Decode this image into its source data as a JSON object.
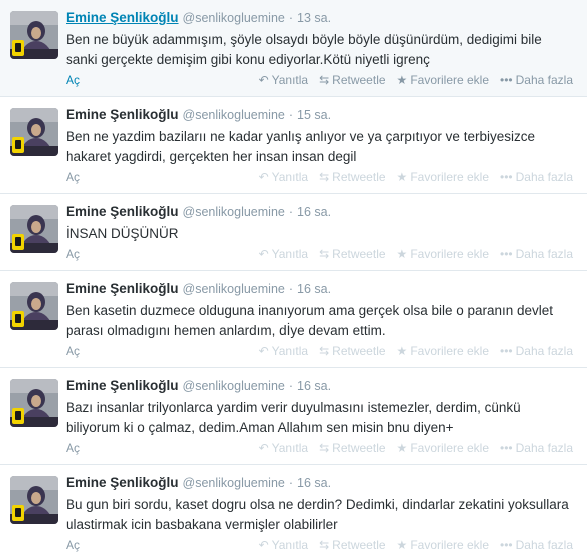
{
  "tweets": [
    {
      "fullname": "Emine Şenlikoğlu",
      "username": "@senlikogluemine",
      "time": "13 sa.",
      "text": "Ben ne büyük adammışım, şöyle olsaydı böyle böyle düşünürdüm, dedigimi bile sanki gerçekte demişim gibi konu ediyorlar.Kötü niyetli igrenç",
      "expand": "Aç",
      "reply": "Yanıtla",
      "retweet": "Retweetle",
      "favorite": "Favorilere ekle",
      "more": "Daha fazla"
    },
    {
      "fullname": "Emine Şenlikoğlu",
      "username": "@senlikogluemine",
      "time": "15 sa.",
      "text": "Ben ne yazdim bazilarıı ne kadar yanlış anlıyor ve ya çarpıtıyor ve terbiyesizce hakaret yagdirdi, gerçekten her insan insan degil",
      "expand": "Aç",
      "reply": "Yanıtla",
      "retweet": "Retweetle",
      "favorite": "Favorilere ekle",
      "more": "Daha fazla"
    },
    {
      "fullname": "Emine Şenlikoğlu",
      "username": "@senlikogluemine",
      "time": "16 sa.",
      "text": "İNSAN DÜŞÜNÜR",
      "expand": "Aç",
      "reply": "Yanıtla",
      "retweet": "Retweetle",
      "favorite": "Favorilere ekle",
      "more": "Daha fazla"
    },
    {
      "fullname": "Emine Şenlikoğlu",
      "username": "@senlikogluemine",
      "time": "16 sa.",
      "text": "Ben kasetin duzmece olduguna inanıyorum ama gerçek olsa bile o paranın devlet parası olmadıgını hemen anlardım, dİye devam ettim.",
      "expand": "Aç",
      "reply": "Yanıtla",
      "retweet": "Retweetle",
      "favorite": "Favorilere ekle",
      "more": "Daha fazla"
    },
    {
      "fullname": "Emine Şenlikoğlu",
      "username": "@senlikogluemine",
      "time": "16 sa.",
      "text": "Bazı insanlar trilyonlarca yardim verir duyulmasını istemezler, derdim, cünkü biliyorum ki o çalmaz, dedim.Aman Allahım sen misin bnu diyen+",
      "expand": "Aç",
      "reply": "Yanıtla",
      "retweet": "Retweetle",
      "favorite": "Favorilere ekle",
      "more": "Daha fazla"
    },
    {
      "fullname": "Emine Şenlikoğlu",
      "username": "@senlikogluemine",
      "time": "16 sa.",
      "text": "Bu gun biri sordu, kaset dogru olsa ne derdin? Dedimki, dindarlar zekatini yoksullara ulastirmak icin basbakana vermişler olabilirler",
      "expand": "Aç",
      "reply": "Yanıtla",
      "retweet": "Retweetle",
      "favorite": "Favorilere ekle",
      "more": "Daha fazla"
    }
  ],
  "icons": {
    "reply": "reply-icon",
    "retweet": "retweet-icon",
    "favorite": "star-icon",
    "more": "more-dots-icon"
  },
  "colors": {
    "link": "#0084b4",
    "muted": "#8899a6",
    "faint": "#ccd6dd",
    "text": "#292f33",
    "hover_bg": "#f5f8fa"
  }
}
